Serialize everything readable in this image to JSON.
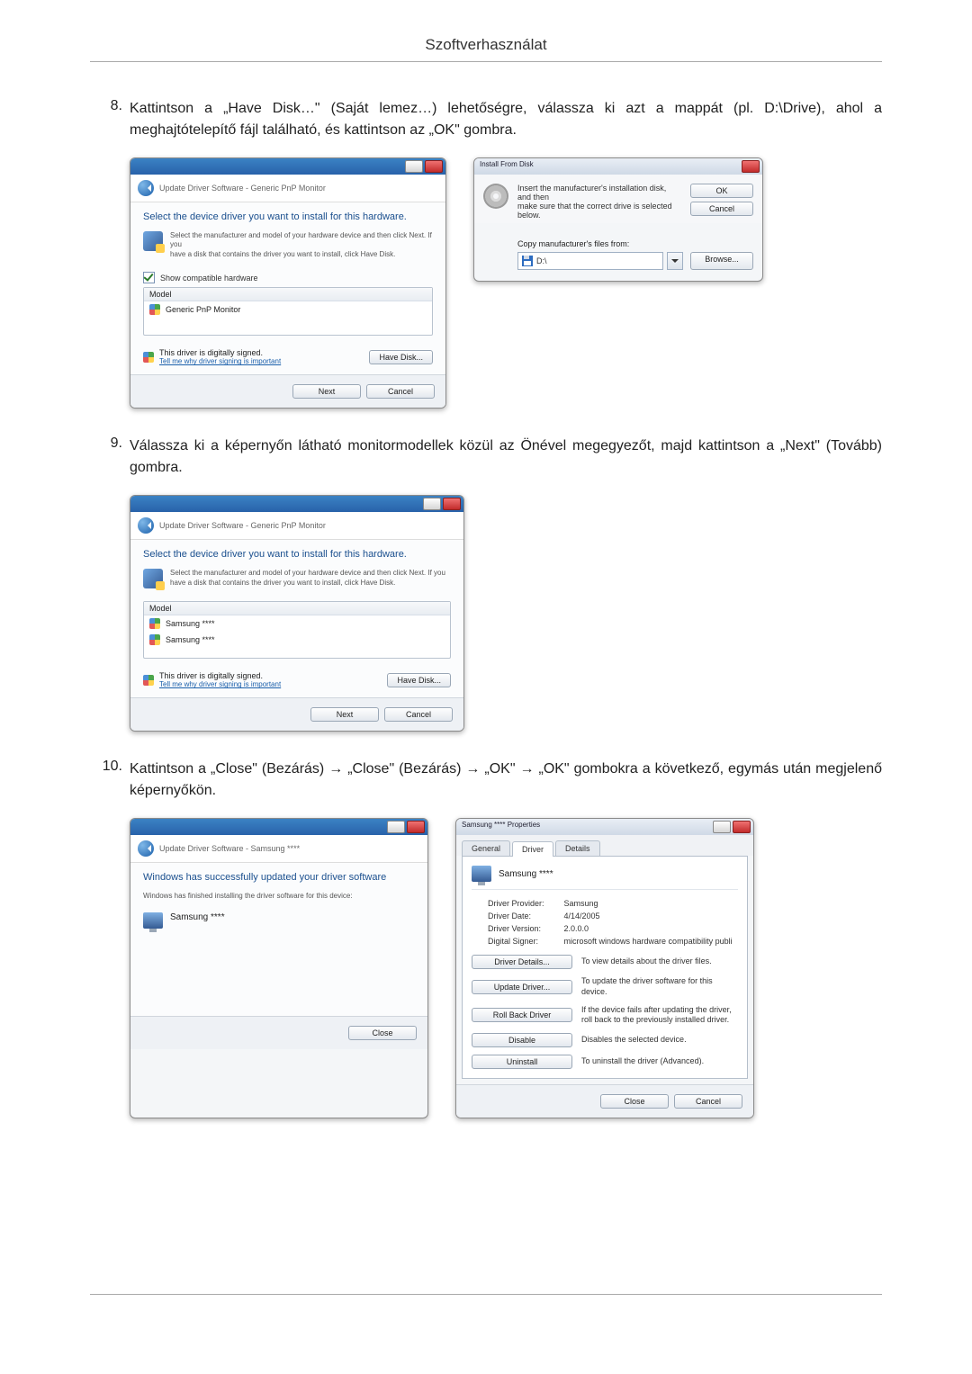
{
  "header": {
    "title": "Szoftverhasználat"
  },
  "steps": {
    "s8": {
      "num": "8.",
      "text": "Kattintson a „Have Disk…\" (Saját lemez…) lehetőségre, válassza ki azt a mappát (pl. D:\\Drive), ahol a meghajtótelepítő fájl található, és kattintson az „OK\" gombra."
    },
    "s9": {
      "num": "9.",
      "text": "Válassza ki a képernyőn látható monitormodellek közül az Önével megegyezőt, majd kattintson a „Next\" (Tovább) gombra."
    },
    "s10": {
      "num": "10.",
      "text": "Kattintson a „Close\" (Bezárás) → „Close\" (Bezárás) → „OK\" → „OK\" gombokra a következő, egymás után megjelenő képernyőkön."
    }
  },
  "dlg8a": {
    "crumb": "Update Driver Software - Generic PnP Monitor",
    "heading": "Select the device driver you want to install for this hardware.",
    "hint1": "Select the manufacturer and model of your hardware device and then click Next. If you",
    "hint2": "have a disk that contains the driver you want to install, click Have Disk.",
    "showcompat": "Show compatible hardware",
    "model_head": "Model",
    "model1": "Generic PnP Monitor",
    "signed": "This driver is digitally signed.",
    "tellme": "Tell me why driver signing is important",
    "have_disk": "Have Disk...",
    "next": "Next",
    "cancel": "Cancel"
  },
  "dlg8b": {
    "title": "Install From Disk",
    "msg1": "Insert the manufacturer's installation disk, and then",
    "msg2": "make sure that the correct drive is selected below.",
    "ok": "OK",
    "cancel": "Cancel",
    "copy_label": "Copy manufacturer's files from:",
    "drive": "D:\\",
    "browse": "Browse..."
  },
  "dlg9": {
    "crumb": "Update Driver Software - Generic PnP Monitor",
    "heading": "Select the device driver you want to install for this hardware.",
    "hint1": "Select the manufacturer and model of your hardware device and then click Next. If you",
    "hint2": "have a disk that contains the driver you want to install, click Have Disk.",
    "model_head": "Model",
    "model1": "Samsung ****",
    "model2": "Samsung ****",
    "signed": "This driver is digitally signed.",
    "tellme": "Tell me why driver signing is important",
    "have_disk": "Have Disk...",
    "next": "Next",
    "cancel": "Cancel"
  },
  "dlg10a": {
    "crumb": "Update Driver Software - Samsung ****",
    "heading": "Windows has successfully updated your driver software",
    "sub": "Windows has finished installing the driver software for this device:",
    "device": "Samsung ****",
    "close": "Close"
  },
  "dlg10b": {
    "title": "Samsung **** Properties",
    "tab_general": "General",
    "tab_driver": "Driver",
    "tab_details": "Details",
    "devname": "Samsung ****",
    "rows": {
      "provider_k": "Driver Provider:",
      "provider_v": "Samsung",
      "date_k": "Driver Date:",
      "date_v": "4/14/2005",
      "version_k": "Driver Version:",
      "version_v": "2.0.0.0",
      "signer_k": "Digital Signer:",
      "signer_v": "microsoft windows hardware compatibility publi"
    },
    "btns": {
      "details": "Driver Details...",
      "details_desc": "To view details about the driver files.",
      "update": "Update Driver...",
      "update_desc": "To update the driver software for this device.",
      "rollback": "Roll Back Driver",
      "rollback_desc": "If the device fails after updating the driver, roll back to the previously installed driver.",
      "disable": "Disable",
      "disable_desc": "Disables the selected device.",
      "uninstall": "Uninstall",
      "uninstall_desc": "To uninstall the driver (Advanced)."
    },
    "close": "Close",
    "cancel": "Cancel"
  }
}
